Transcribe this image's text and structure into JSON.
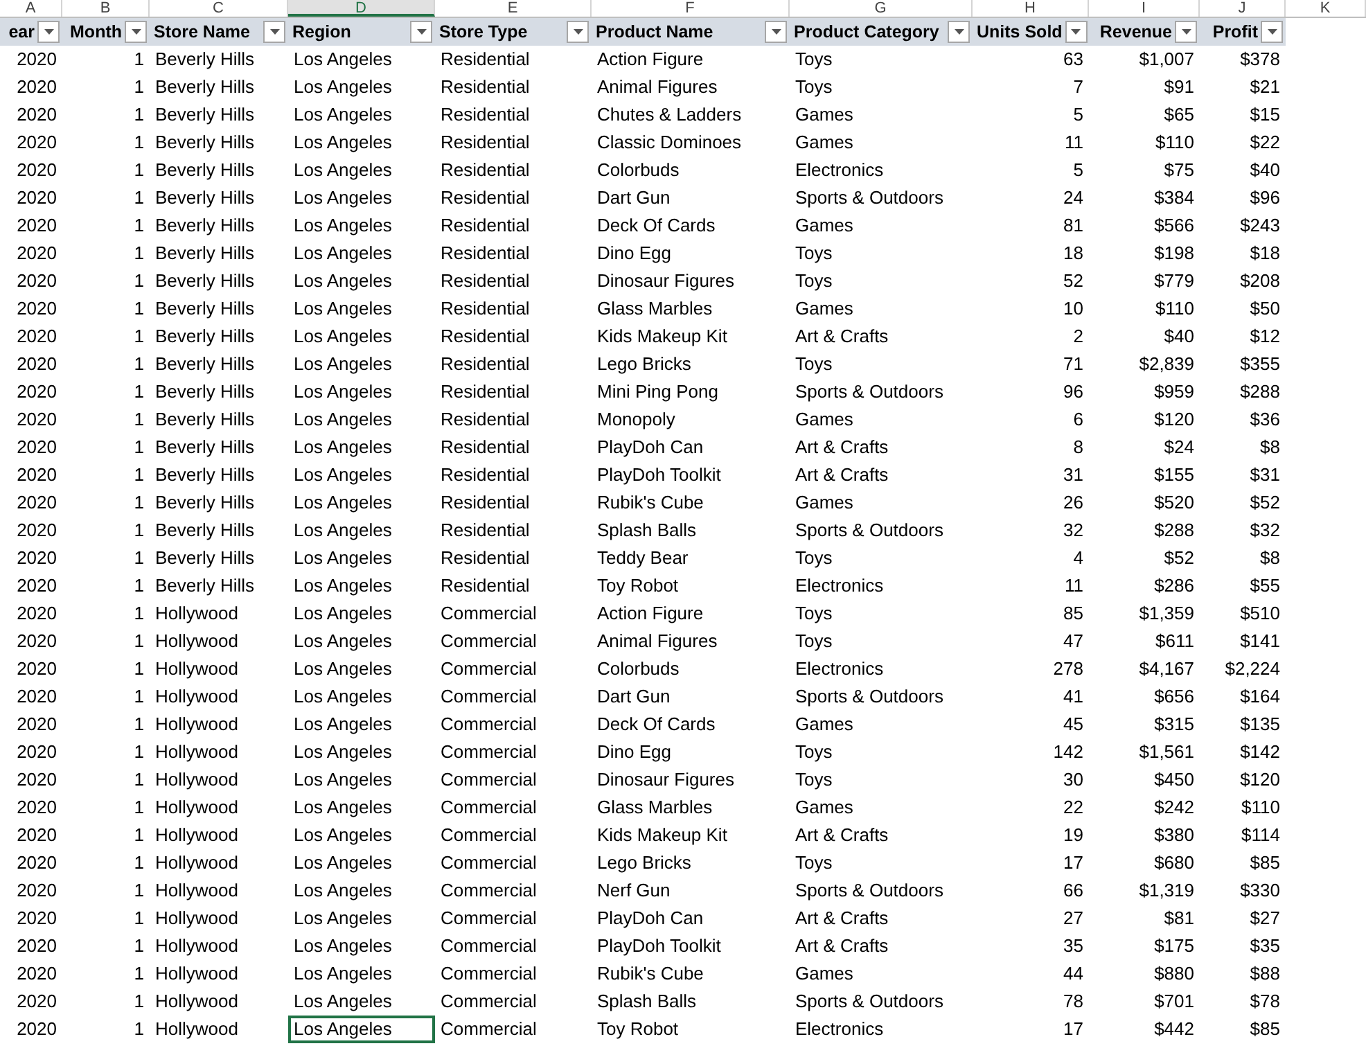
{
  "columns": [
    {
      "letter": "A",
      "heading": "ear",
      "numeric": true,
      "selected": false
    },
    {
      "letter": "B",
      "heading": "Month",
      "numeric": true,
      "selected": false
    },
    {
      "letter": "C",
      "heading": "Store Name",
      "numeric": false,
      "selected": false
    },
    {
      "letter": "D",
      "heading": "Region",
      "numeric": false,
      "selected": true
    },
    {
      "letter": "E",
      "heading": "Store Type",
      "numeric": false,
      "selected": false
    },
    {
      "letter": "F",
      "heading": "Product Name",
      "numeric": false,
      "selected": false
    },
    {
      "letter": "G",
      "heading": "Product Category",
      "numeric": false,
      "selected": false
    },
    {
      "letter": "H",
      "heading": "Units Sold",
      "numeric": true,
      "selected": false
    },
    {
      "letter": "I",
      "heading": "Revenue",
      "numeric": true,
      "selected": false
    },
    {
      "letter": "J",
      "heading": "Profit",
      "numeric": true,
      "selected": false
    },
    {
      "letter": "K",
      "selected": false
    }
  ],
  "rows": [
    {
      "selected": false,
      "cells": [
        "2020",
        "1",
        "Beverly Hills",
        "Los Angeles",
        "Residential",
        "Action Figure",
        "Toys",
        "63",
        "$1,007",
        "$378"
      ]
    },
    {
      "selected": false,
      "cells": [
        "2020",
        "1",
        "Beverly Hills",
        "Los Angeles",
        "Residential",
        "Animal Figures",
        "Toys",
        "7",
        "$91",
        "$21"
      ]
    },
    {
      "selected": false,
      "cells": [
        "2020",
        "1",
        "Beverly Hills",
        "Los Angeles",
        "Residential",
        "Chutes & Ladders",
        "Games",
        "5",
        "$65",
        "$15"
      ]
    },
    {
      "selected": false,
      "cells": [
        "2020",
        "1",
        "Beverly Hills",
        "Los Angeles",
        "Residential",
        "Classic Dominoes",
        "Games",
        "11",
        "$110",
        "$22"
      ]
    },
    {
      "selected": false,
      "cells": [
        "2020",
        "1",
        "Beverly Hills",
        "Los Angeles",
        "Residential",
        "Colorbuds",
        "Electronics",
        "5",
        "$75",
        "$40"
      ]
    },
    {
      "selected": false,
      "cells": [
        "2020",
        "1",
        "Beverly Hills",
        "Los Angeles",
        "Residential",
        "Dart Gun",
        "Sports & Outdoors",
        "24",
        "$384",
        "$96"
      ]
    },
    {
      "selected": false,
      "cells": [
        "2020",
        "1",
        "Beverly Hills",
        "Los Angeles",
        "Residential",
        "Deck Of Cards",
        "Games",
        "81",
        "$566",
        "$243"
      ]
    },
    {
      "selected": false,
      "cells": [
        "2020",
        "1",
        "Beverly Hills",
        "Los Angeles",
        "Residential",
        "Dino Egg",
        "Toys",
        "18",
        "$198",
        "$18"
      ]
    },
    {
      "selected": false,
      "cells": [
        "2020",
        "1",
        "Beverly Hills",
        "Los Angeles",
        "Residential",
        "Dinosaur Figures",
        "Toys",
        "52",
        "$779",
        "$208"
      ]
    },
    {
      "selected": false,
      "cells": [
        "2020",
        "1",
        "Beverly Hills",
        "Los Angeles",
        "Residential",
        "Glass Marbles",
        "Games",
        "10",
        "$110",
        "$50"
      ]
    },
    {
      "selected": false,
      "cells": [
        "2020",
        "1",
        "Beverly Hills",
        "Los Angeles",
        "Residential",
        "Kids Makeup Kit",
        "Art & Crafts",
        "2",
        "$40",
        "$12"
      ]
    },
    {
      "selected": false,
      "cells": [
        "2020",
        "1",
        "Beverly Hills",
        "Los Angeles",
        "Residential",
        "Lego Bricks",
        "Toys",
        "71",
        "$2,839",
        "$355"
      ]
    },
    {
      "selected": false,
      "cells": [
        "2020",
        "1",
        "Beverly Hills",
        "Los Angeles",
        "Residential",
        "Mini Ping Pong",
        "Sports & Outdoors",
        "96",
        "$959",
        "$288"
      ]
    },
    {
      "selected": false,
      "cells": [
        "2020",
        "1",
        "Beverly Hills",
        "Los Angeles",
        "Residential",
        "Monopoly",
        "Games",
        "6",
        "$120",
        "$36"
      ]
    },
    {
      "selected": false,
      "cells": [
        "2020",
        "1",
        "Beverly Hills",
        "Los Angeles",
        "Residential",
        "PlayDoh Can",
        "Art & Crafts",
        "8",
        "$24",
        "$8"
      ]
    },
    {
      "selected": false,
      "cells": [
        "2020",
        "1",
        "Beverly Hills",
        "Los Angeles",
        "Residential",
        "PlayDoh Toolkit",
        "Art & Crafts",
        "31",
        "$155",
        "$31"
      ]
    },
    {
      "selected": false,
      "cells": [
        "2020",
        "1",
        "Beverly Hills",
        "Los Angeles",
        "Residential",
        "Rubik's Cube",
        "Games",
        "26",
        "$520",
        "$52"
      ]
    },
    {
      "selected": false,
      "cells": [
        "2020",
        "1",
        "Beverly Hills",
        "Los Angeles",
        "Residential",
        "Splash Balls",
        "Sports & Outdoors",
        "32",
        "$288",
        "$32"
      ]
    },
    {
      "selected": false,
      "cells": [
        "2020",
        "1",
        "Beverly Hills",
        "Los Angeles",
        "Residential",
        "Teddy Bear",
        "Toys",
        "4",
        "$52",
        "$8"
      ]
    },
    {
      "selected": false,
      "cells": [
        "2020",
        "1",
        "Beverly Hills",
        "Los Angeles",
        "Residential",
        "Toy Robot",
        "Electronics",
        "11",
        "$286",
        "$55"
      ]
    },
    {
      "selected": false,
      "cells": [
        "2020",
        "1",
        "Hollywood",
        "Los Angeles",
        "Commercial",
        "Action Figure",
        "Toys",
        "85",
        "$1,359",
        "$510"
      ]
    },
    {
      "selected": false,
      "cells": [
        "2020",
        "1",
        "Hollywood",
        "Los Angeles",
        "Commercial",
        "Animal Figures",
        "Toys",
        "47",
        "$611",
        "$141"
      ]
    },
    {
      "selected": false,
      "cells": [
        "2020",
        "1",
        "Hollywood",
        "Los Angeles",
        "Commercial",
        "Colorbuds",
        "Electronics",
        "278",
        "$4,167",
        "$2,224"
      ]
    },
    {
      "selected": false,
      "cells": [
        "2020",
        "1",
        "Hollywood",
        "Los Angeles",
        "Commercial",
        "Dart Gun",
        "Sports & Outdoors",
        "41",
        "$656",
        "$164"
      ]
    },
    {
      "selected": false,
      "cells": [
        "2020",
        "1",
        "Hollywood",
        "Los Angeles",
        "Commercial",
        "Deck Of Cards",
        "Games",
        "45",
        "$315",
        "$135"
      ]
    },
    {
      "selected": false,
      "cells": [
        "2020",
        "1",
        "Hollywood",
        "Los Angeles",
        "Commercial",
        "Dino Egg",
        "Toys",
        "142",
        "$1,561",
        "$142"
      ]
    },
    {
      "selected": false,
      "cells": [
        "2020",
        "1",
        "Hollywood",
        "Los Angeles",
        "Commercial",
        "Dinosaur Figures",
        "Toys",
        "30",
        "$450",
        "$120"
      ]
    },
    {
      "selected": false,
      "cells": [
        "2020",
        "1",
        "Hollywood",
        "Los Angeles",
        "Commercial",
        "Glass Marbles",
        "Games",
        "22",
        "$242",
        "$110"
      ]
    },
    {
      "selected": false,
      "cells": [
        "2020",
        "1",
        "Hollywood",
        "Los Angeles",
        "Commercial",
        "Kids Makeup Kit",
        "Art & Crafts",
        "19",
        "$380",
        "$114"
      ]
    },
    {
      "selected": false,
      "cells": [
        "2020",
        "1",
        "Hollywood",
        "Los Angeles",
        "Commercial",
        "Lego Bricks",
        "Toys",
        "17",
        "$680",
        "$85"
      ]
    },
    {
      "selected": false,
      "cells": [
        "2020",
        "1",
        "Hollywood",
        "Los Angeles",
        "Commercial",
        "Nerf Gun",
        "Sports & Outdoors",
        "66",
        "$1,319",
        "$330"
      ]
    },
    {
      "selected": false,
      "cells": [
        "2020",
        "1",
        "Hollywood",
        "Los Angeles",
        "Commercial",
        "PlayDoh Can",
        "Art & Crafts",
        "27",
        "$81",
        "$27"
      ]
    },
    {
      "selected": false,
      "cells": [
        "2020",
        "1",
        "Hollywood",
        "Los Angeles",
        "Commercial",
        "PlayDoh Toolkit",
        "Art & Crafts",
        "35",
        "$175",
        "$35"
      ]
    },
    {
      "selected": false,
      "cells": [
        "2020",
        "1",
        "Hollywood",
        "Los Angeles",
        "Commercial",
        "Rubik's Cube",
        "Games",
        "44",
        "$880",
        "$88"
      ]
    },
    {
      "selected": false,
      "cells": [
        "2020",
        "1",
        "Hollywood",
        "Los Angeles",
        "Commercial",
        "Splash Balls",
        "Sports & Outdoors",
        "78",
        "$701",
        "$78"
      ]
    },
    {
      "selected": true,
      "cells": [
        "2020",
        "1",
        "Hollywood",
        "Los Angeles",
        "Commercial",
        "Toy Robot",
        "Electronics",
        "17",
        "$442",
        "$85"
      ]
    }
  ]
}
